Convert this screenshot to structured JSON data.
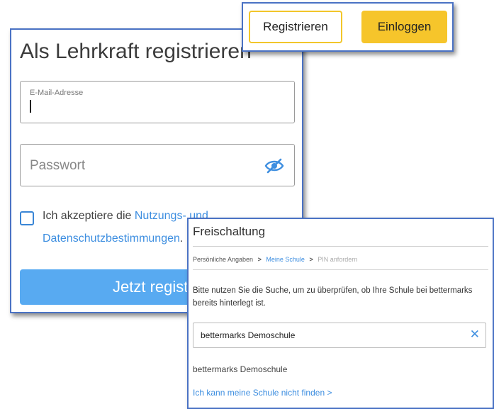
{
  "register_tabs": {
    "register_label": "Registrieren",
    "login_label": "Einloggen"
  },
  "registration": {
    "title": "Als Lehrkraft registrieren",
    "email_label": "E-Mail-Adresse",
    "password_placeholder": "Passwort",
    "terms_prefix": "Ich akzeptiere die",
    "terms_link_part1": "Nutzungs- und",
    "terms_link_part2": "Datenschutzbestimmungen",
    "terms_suffix": ".",
    "submit_label": "Jetzt registrieren"
  },
  "activation": {
    "title": "Freischaltung",
    "breadcrumbs": [
      "Persönliche Angaben",
      "Meine Schule",
      "PIN anfordern"
    ],
    "breadcrumb_separator": ">",
    "hint": "Bitte nutzen Sie die Suche, um zu überprüfen, ob Ihre Schule bei bettermarks bereits hinterlegt ist.",
    "search_value": "bettermarks Demoschule",
    "clear_symbol": "✕",
    "result": "bettermarks Demoschule",
    "not_found_link": "Ich kann meine Schule nicht finden",
    "not_found_arrow": ">"
  },
  "colors": {
    "accent_blue": "#3d8ee0",
    "button_blue": "#58aaf1",
    "yellow": "#f6c52b",
    "panel_border": "#4a72c4"
  }
}
